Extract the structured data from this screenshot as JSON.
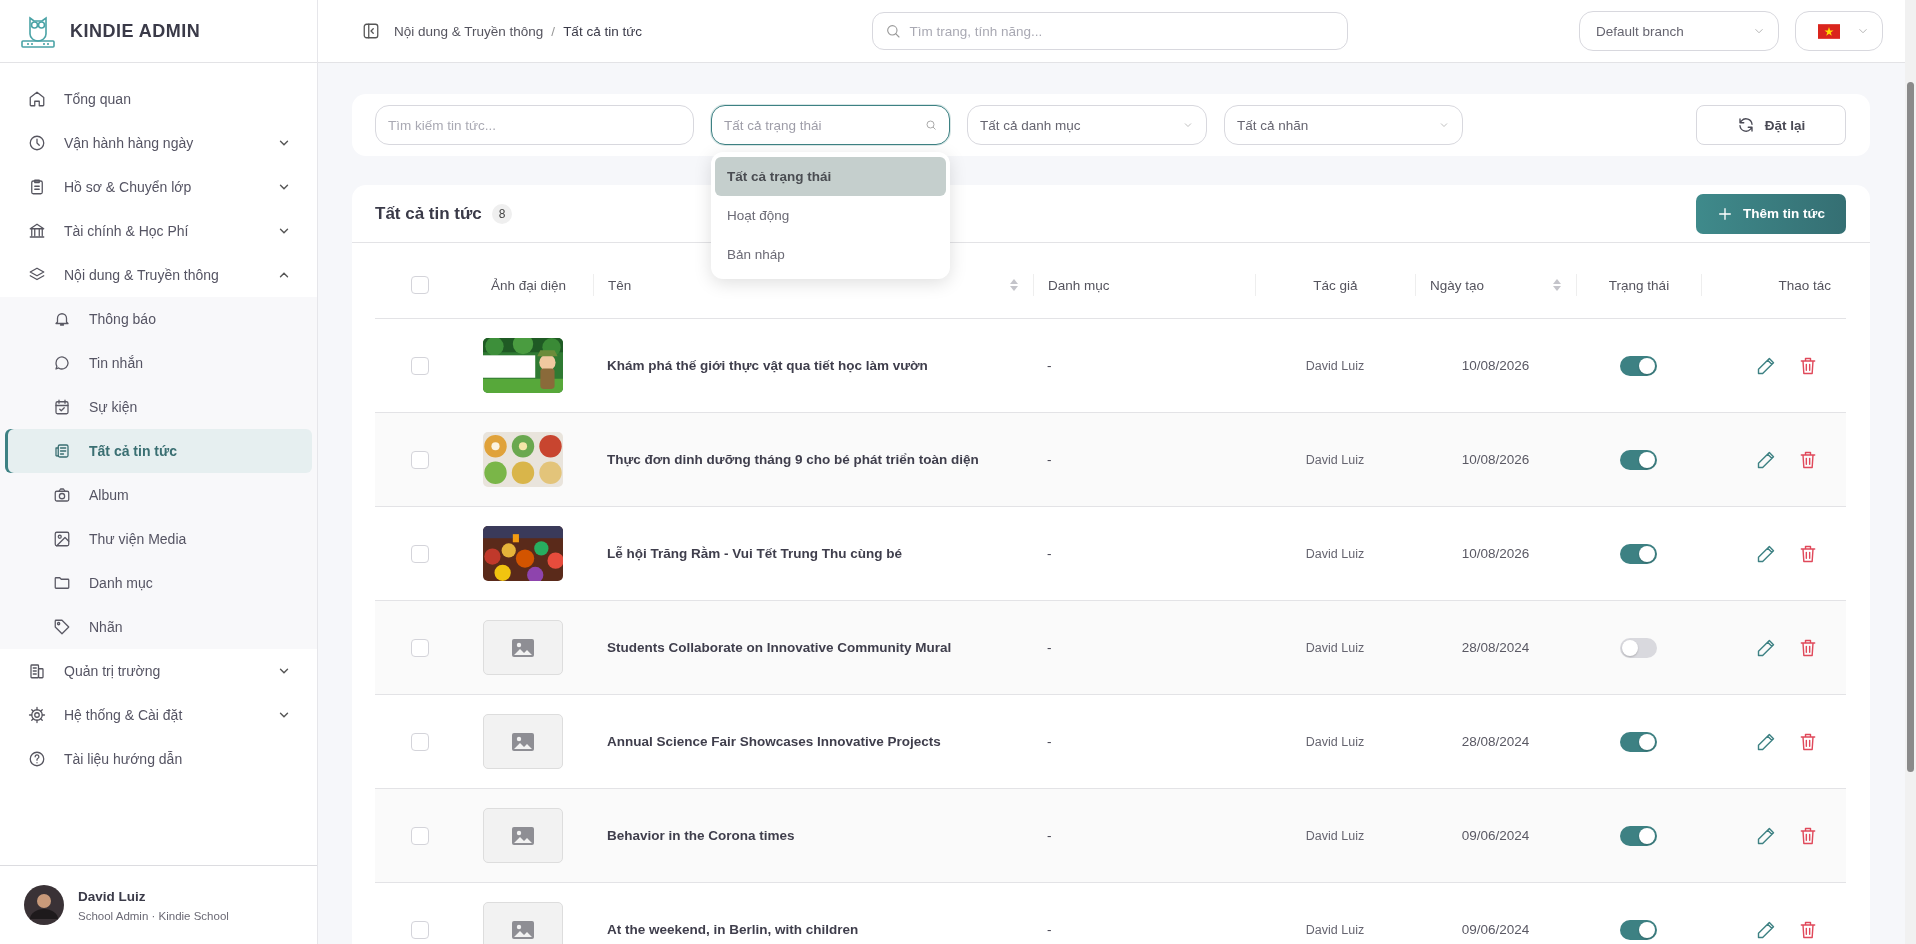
{
  "app": {
    "logo_text": "KINDIE ADMIN"
  },
  "sidebar": {
    "items": [
      {
        "label": "Tổng quan",
        "selected": false
      },
      {
        "label": "Vận hành hàng ngày",
        "selected": false,
        "expanded": false
      },
      {
        "label": "Hồ sơ & Chuyển lớp",
        "selected": false,
        "expanded": false
      },
      {
        "label": "Tài chính & Học Phí",
        "selected": false,
        "expanded": false
      },
      {
        "label": "Nội dung & Truyền thông",
        "selected": false,
        "expanded": true,
        "children": [
          {
            "label": "Thông báo",
            "selected": false
          },
          {
            "label": "Tin nhắn",
            "selected": false
          },
          {
            "label": "Sự kiện",
            "selected": false
          },
          {
            "label": "Tất cả tin tức",
            "selected": true
          },
          {
            "label": "Album",
            "selected": false
          },
          {
            "label": "Thư viện Media",
            "selected": false
          },
          {
            "label": "Danh mục",
            "selected": false
          },
          {
            "label": "Nhãn",
            "selected": false
          }
        ]
      },
      {
        "label": "Quản trị trường",
        "selected": false,
        "expanded": false
      },
      {
        "label": "Hệ thống & Cài đặt",
        "selected": false,
        "expanded": false
      },
      {
        "label": "Tài liệu hướng dẫn",
        "selected": false
      }
    ]
  },
  "user": {
    "name": "David Luiz",
    "role": "School Admin · Kindie School"
  },
  "header": {
    "breadcrumb": [
      "Nội dung & Truyền thông",
      "Tất cả tin tức"
    ],
    "separator": "/",
    "search_placeholder": "Tìm trang, tính năng...",
    "branch": "Default branch"
  },
  "filters": {
    "search_placeholder": "Tìm kiếm tin tức...",
    "status": {
      "placeholder": "Tất cả trạng thái",
      "expanded": true,
      "options": [
        {
          "label": "Tất cả trạng thái",
          "selected": true
        },
        {
          "label": "Hoạt động",
          "selected": false
        },
        {
          "label": "Bản nháp",
          "selected": false
        }
      ]
    },
    "category_placeholder": "Tất cả danh mục",
    "tag_placeholder": "Tất cả nhãn",
    "reset": "Đặt lại"
  },
  "table": {
    "title": "Tất cả tin tức",
    "count": "8",
    "add_button": "Thêm tin tức",
    "select_all": {
      "checked": false
    },
    "columns": [
      {
        "label": "Ảnh đại diện",
        "sortable": false
      },
      {
        "label": "Tên",
        "sortable": true
      },
      {
        "label": "Danh mục",
        "sortable": false
      },
      {
        "label": "Tác giả",
        "sortable": false
      },
      {
        "label": "Ngày tạo",
        "sortable": true
      },
      {
        "label": "Trạng thái",
        "sortable": false
      },
      {
        "label": "Thao tác",
        "sortable": false
      }
    ],
    "rows": [
      {
        "checked": false,
        "title": "Khám phá thế giới thực vật qua tiết học làm vườn",
        "category": "-",
        "author": "David Luiz",
        "date": "10/08/2026",
        "active": true
      },
      {
        "checked": false,
        "title": "Thực đơn dinh dưỡng tháng 9 cho bé phát triển toàn diện",
        "category": "-",
        "author": "David Luiz",
        "date": "10/08/2026",
        "active": true
      },
      {
        "checked": false,
        "title": "Lễ hội Trăng Rằm - Vui Tết Trung Thu cùng bé",
        "category": "-",
        "author": "David Luiz",
        "date": "10/08/2026",
        "active": true
      },
      {
        "checked": false,
        "thumbnail": {
          "kind": "placeholder"
        },
        "title": "Students Collaborate on Innovative Community Mural",
        "category": "-",
        "author": "David Luiz",
        "date": "28/08/2024",
        "active": false
      },
      {
        "checked": false,
        "thumbnail": {
          "kind": "placeholder"
        },
        "title": "Annual Science Fair Showcases Innovative Projects",
        "category": "-",
        "author": "David Luiz",
        "date": "28/08/2024",
        "active": true
      },
      {
        "checked": false,
        "thumbnail": {
          "kind": "placeholder"
        },
        "title": "Behavior in the Corona times",
        "category": "-",
        "author": "David Luiz",
        "date": "09/06/2024",
        "active": true
      },
      {
        "checked": false,
        "thumbnail": {
          "kind": "placeholder"
        },
        "title": "At the weekend, in Berlin, with children",
        "category": "-",
        "author": "David Luiz",
        "date": "09/06/2024",
        "active": true
      }
    ]
  }
}
